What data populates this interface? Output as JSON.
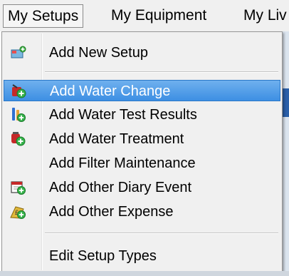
{
  "menubar": {
    "items": [
      {
        "label": "My Setups"
      },
      {
        "label": "My Equipment"
      },
      {
        "label": "My Liv"
      }
    ]
  },
  "dropdown": {
    "items": [
      {
        "label": "Add New Setup",
        "icon": "new-setup-icon"
      },
      {
        "label": "Add Water Change",
        "icon": "water-change-icon",
        "highlighted": true
      },
      {
        "label": "Add Water Test Results",
        "icon": "water-test-icon"
      },
      {
        "label": "Add Water Treatment",
        "icon": "water-treatment-icon"
      },
      {
        "label": "Add Filter Maintenance",
        "icon": ""
      },
      {
        "label": "Add Other Diary Event",
        "icon": "diary-event-icon"
      },
      {
        "label": "Add Other Expense",
        "icon": "expense-icon"
      },
      {
        "label": "Edit Setup Types",
        "icon": ""
      }
    ]
  },
  "colors": {
    "highlight": "#3d8fe3",
    "menu_bg": "#f0f0f0"
  }
}
